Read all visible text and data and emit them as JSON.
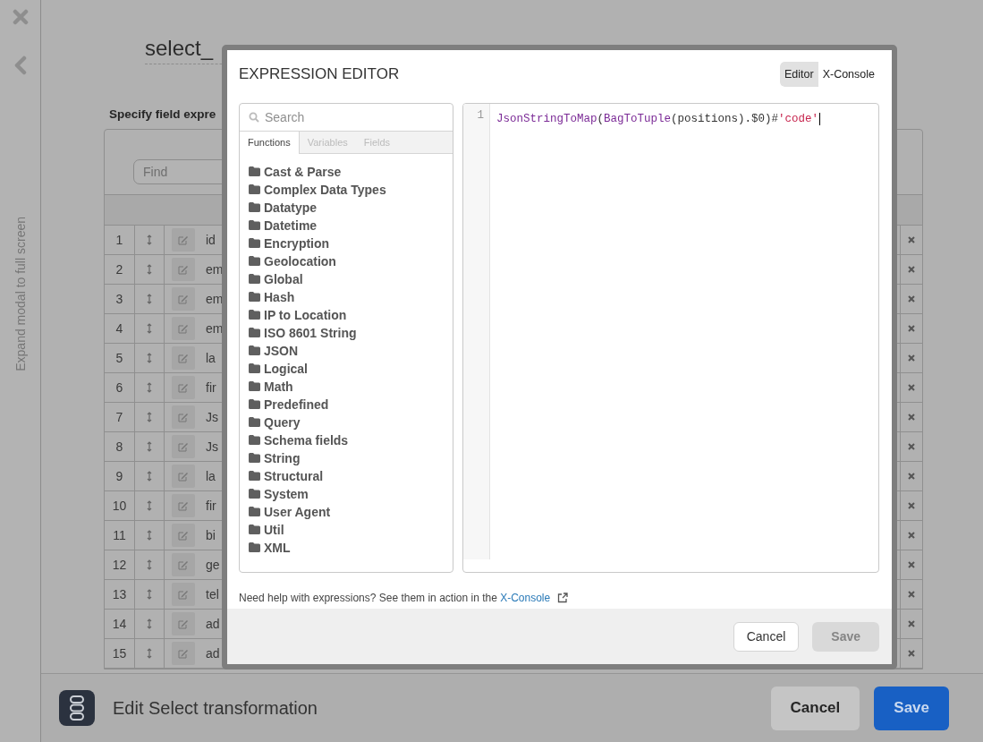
{
  "sidebar": {
    "expand_label": "Expand modal to full screen"
  },
  "page": {
    "title": "select_",
    "section_heading": "Specify field expre",
    "find": {
      "placeholder": "Find"
    },
    "rows": [
      {
        "number": "1",
        "name": "id"
      },
      {
        "number": "2",
        "name": "em"
      },
      {
        "number": "3",
        "name": "em"
      },
      {
        "number": "4",
        "name": "em"
      },
      {
        "number": "5",
        "name": "la"
      },
      {
        "number": "6",
        "name": "fir"
      },
      {
        "number": "7",
        "name": "Js"
      },
      {
        "number": "8",
        "name": "Js"
      },
      {
        "number": "9",
        "name": "la"
      },
      {
        "number": "10",
        "name": "fir"
      },
      {
        "number": "11",
        "name": "bi"
      },
      {
        "number": "12",
        "name": "ge"
      },
      {
        "number": "13",
        "name": "tel"
      },
      {
        "number": "14",
        "name": "ad"
      },
      {
        "number": "15",
        "name": "ad"
      }
    ]
  },
  "footer": {
    "title": "Edit Select transformation",
    "buttons": [
      {
        "label": "Cancel",
        "kind": "secondary"
      },
      {
        "label": "Save",
        "kind": "primary"
      }
    ]
  },
  "dialog": {
    "title": "EXPRESSION EDITOR",
    "mode_tabs": [
      {
        "label": "Editor",
        "selected": true
      },
      {
        "label": "X-Console",
        "selected": false
      }
    ],
    "search": {
      "placeholder": "Search"
    },
    "tabs": [
      {
        "label": "Functions",
        "selected": true
      },
      {
        "label": "Variables",
        "selected": false
      },
      {
        "label": "Fields",
        "selected": false
      }
    ],
    "categories": [
      "Cast & Parse",
      "Complex Data Types",
      "Datatype",
      "Datetime",
      "Encryption",
      "Geolocation",
      "Global",
      "Hash",
      "IP to Location",
      "ISO 8601 String",
      "JSON",
      "Logical",
      "Math",
      "Predefined",
      "Query",
      "Schema fields",
      "String",
      "Structural",
      "System",
      "User Agent",
      "Util",
      "XML"
    ],
    "editor": {
      "line_number": "1",
      "code": [
        {
          "text": "JsonStringToMap",
          "kind": "function"
        },
        {
          "text": "(",
          "kind": "plain"
        },
        {
          "text": "BagToTuple",
          "kind": "function"
        },
        {
          "text": "(positions).$0)#",
          "kind": "plain"
        },
        {
          "text": "'code'",
          "kind": "string"
        }
      ]
    },
    "help": {
      "text": "Need help with expressions? See them in action in the ",
      "link": "X-Console"
    },
    "buttons": [
      {
        "label": "Cancel",
        "kind": "secondary",
        "disabled": false
      },
      {
        "label": "Save",
        "kind": "primary",
        "disabled": true
      }
    ]
  }
}
